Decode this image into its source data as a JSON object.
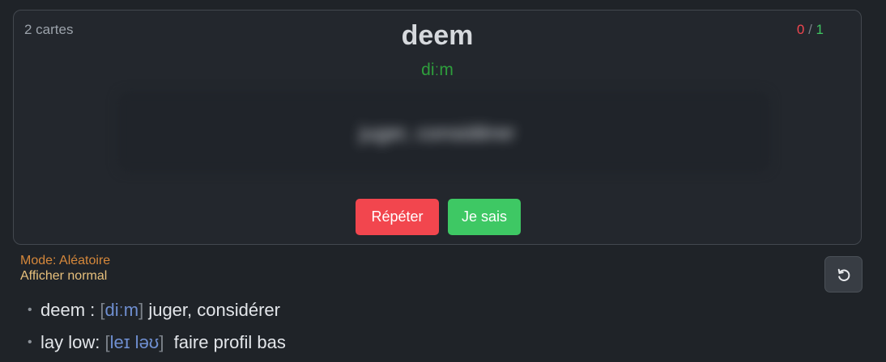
{
  "card": {
    "count": "2 cartes",
    "score": {
      "wrong": "0",
      "sep": "/",
      "right": "1"
    },
    "word": "deem",
    "phonetic": "diːm",
    "hidden_translation": "juger, considérer",
    "buttons": {
      "repeat": "Répéter",
      "know": "Je sais"
    }
  },
  "status": {
    "mode": "Mode: Aléatoire",
    "view": "Afficher normal"
  },
  "reset_button": {
    "icon": "rotate-ccw-icon"
  },
  "vocab_list": [
    {
      "word": "deem :",
      "phonetic": "diːm",
      "translation": "juger, considérer"
    },
    {
      "word": "lay low:",
      "phonetic": "leɪ ləʊ",
      "translation": "faire profil bas"
    }
  ],
  "colors": {
    "background": "#1f2328",
    "card_bg": "#23272d",
    "repeat": "#f2464e",
    "know": "#3ec864",
    "phonetic_card": "#2e9e3c",
    "phonetic_list": "#6f8fd1",
    "mode": "#d6883b"
  }
}
